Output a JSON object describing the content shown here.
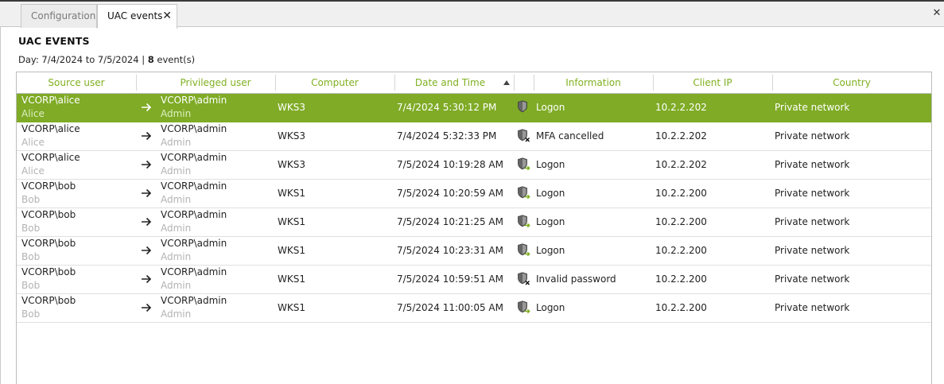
{
  "tabs": [
    {
      "label": "Configuration",
      "active": false
    },
    {
      "label": "UAC events",
      "active": true,
      "close": "✕"
    }
  ],
  "window_close": "✕",
  "page": {
    "title": "UAC EVENTS",
    "summary_prefix": "Day: 7/4/2024 to 7/5/2024 | ",
    "event_count": "8",
    "summary_suffix": " event(s)"
  },
  "colors": {
    "accent": "#7fab26",
    "header_text": "#7fb020",
    "muted": "#b3b3b3"
  },
  "columns": [
    "Source user",
    "Privileged user",
    "Computer",
    "Date and Time",
    "Information",
    "Client IP",
    "Country"
  ],
  "sort": {
    "column": "Date and Time",
    "direction": "ascending"
  },
  "icons": {
    "transition": "arrow-right-icon",
    "logon": "shield-logon-icon",
    "failure": "shield-error-icon"
  },
  "rows": [
    {
      "source_user": "VCORP\\alice",
      "source_name": "Alice",
      "priv_user": "VCORP\\admin",
      "priv_name": "Admin",
      "computer": "WKS3",
      "datetime": "7/4/2024 5:30:12 PM",
      "info": "Logon",
      "info_type": "logon",
      "ip": "10.2.2.202",
      "country": "Private network",
      "selected": true
    },
    {
      "source_user": "VCORP\\alice",
      "source_name": "Alice",
      "priv_user": "VCORP\\admin",
      "priv_name": "Admin",
      "computer": "WKS3",
      "datetime": "7/4/2024 5:32:33 PM",
      "info": "MFA cancelled",
      "info_type": "failure",
      "ip": "10.2.2.202",
      "country": "Private network",
      "selected": false
    },
    {
      "source_user": "VCORP\\alice",
      "source_name": "Alice",
      "priv_user": "VCORP\\admin",
      "priv_name": "Admin",
      "computer": "WKS3",
      "datetime": "7/5/2024 10:19:28 AM",
      "info": "Logon",
      "info_type": "logon",
      "ip": "10.2.2.202",
      "country": "Private network",
      "selected": false
    },
    {
      "source_user": "VCORP\\bob",
      "source_name": "Bob",
      "priv_user": "VCORP\\admin",
      "priv_name": "Admin",
      "computer": "WKS1",
      "datetime": "7/5/2024 10:20:59 AM",
      "info": "Logon",
      "info_type": "logon",
      "ip": "10.2.2.200",
      "country": "Private network",
      "selected": false
    },
    {
      "source_user": "VCORP\\bob",
      "source_name": "Bob",
      "priv_user": "VCORP\\admin",
      "priv_name": "Admin",
      "computer": "WKS1",
      "datetime": "7/5/2024 10:21:25 AM",
      "info": "Logon",
      "info_type": "logon",
      "ip": "10.2.2.200",
      "country": "Private network",
      "selected": false
    },
    {
      "source_user": "VCORP\\bob",
      "source_name": "Bob",
      "priv_user": "VCORP\\admin",
      "priv_name": "Admin",
      "computer": "WKS1",
      "datetime": "7/5/2024 10:23:31 AM",
      "info": "Logon",
      "info_type": "logon",
      "ip": "10.2.2.200",
      "country": "Private network",
      "selected": false
    },
    {
      "source_user": "VCORP\\bob",
      "source_name": "Bob",
      "priv_user": "VCORP\\admin",
      "priv_name": "Admin",
      "computer": "WKS1",
      "datetime": "7/5/2024 10:59:51 AM",
      "info": "Invalid password",
      "info_type": "failure",
      "ip": "10.2.2.200",
      "country": "Private network",
      "selected": false
    },
    {
      "source_user": "VCORP\\bob",
      "source_name": "Bob",
      "priv_user": "VCORP\\admin",
      "priv_name": "Admin",
      "computer": "WKS1",
      "datetime": "7/5/2024 11:00:05 AM",
      "info": "Logon",
      "info_type": "logon",
      "ip": "10.2.2.200",
      "country": "Private network",
      "selected": false
    }
  ]
}
